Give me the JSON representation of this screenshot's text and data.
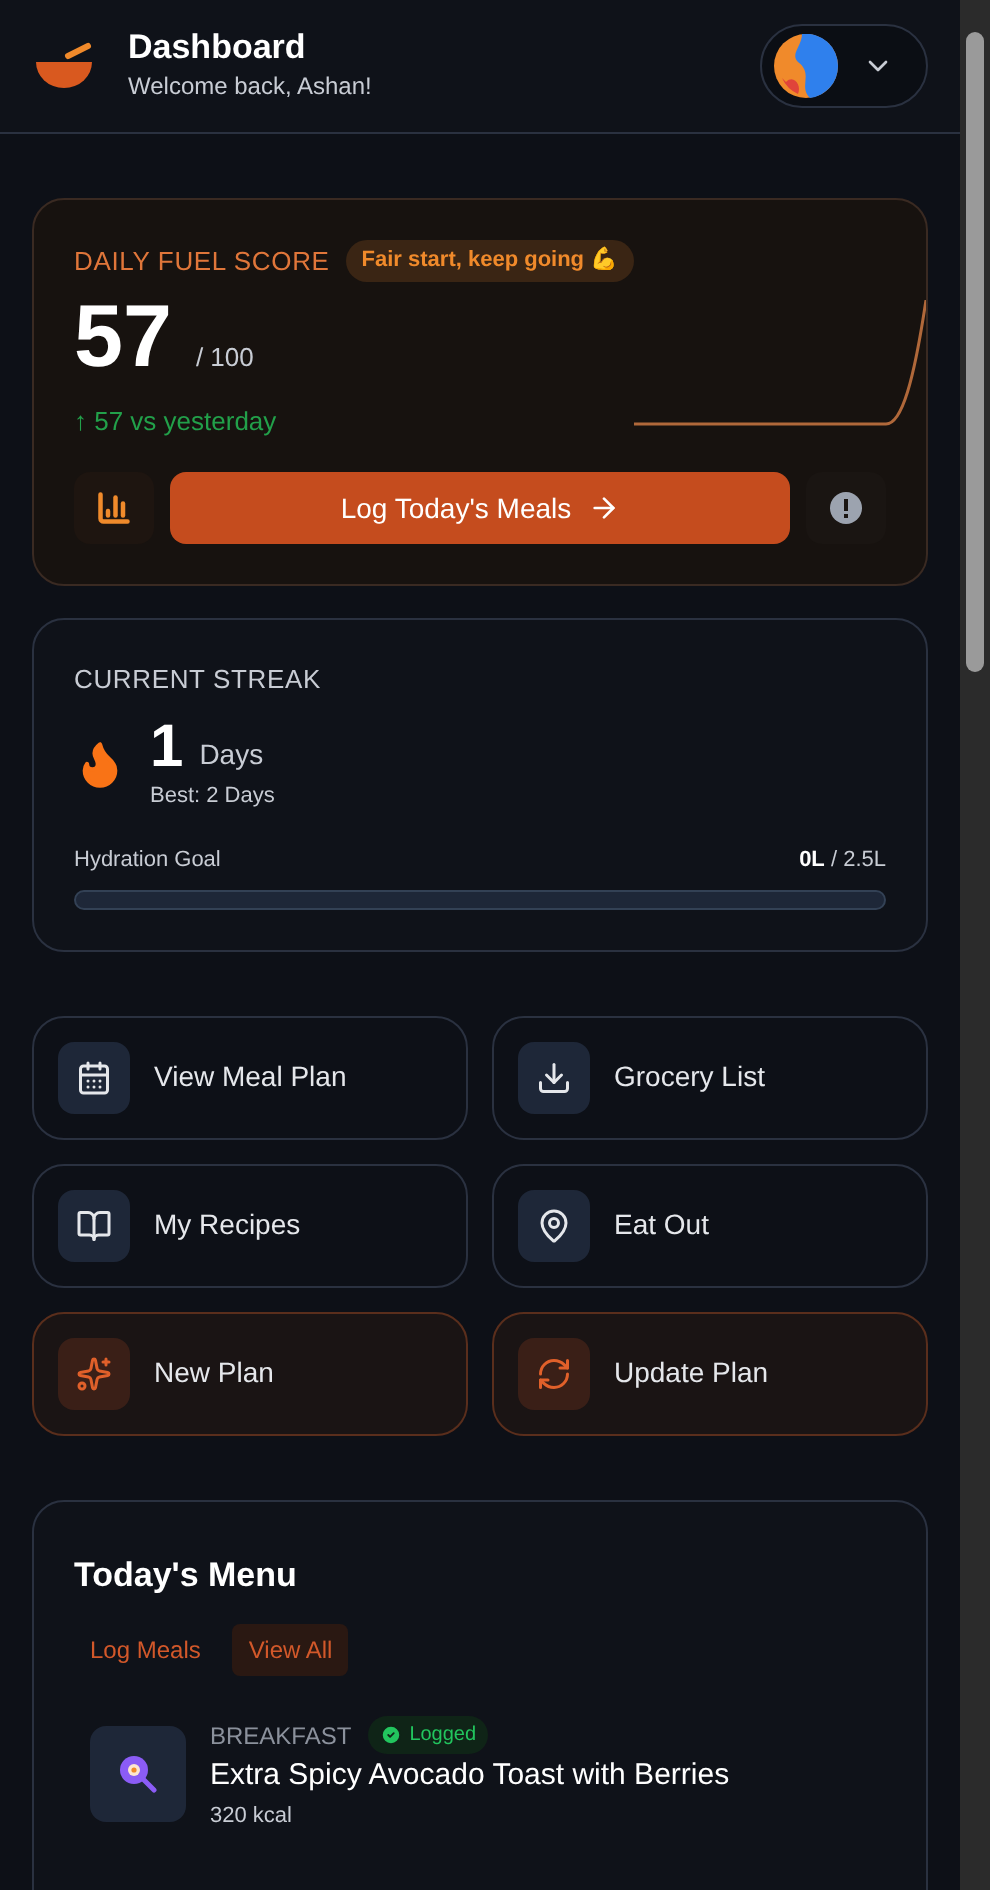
{
  "header": {
    "title": "Dashboard",
    "subtitle": "Welcome back, Ashan!"
  },
  "fuel_score": {
    "label": "DAILY FUEL SCORE",
    "badge": "Fair start, keep going 💪",
    "score": "57",
    "max": "/ 100",
    "change": "↑ 57 vs yesterday",
    "button": "Log Today's Meals"
  },
  "streak": {
    "label": "CURRENT STREAK",
    "count": "1",
    "unit": "Days",
    "best": "Best: 2 Days",
    "hydration_label": "Hydration Goal",
    "hydration_current": "0L",
    "hydration_goal": "/ 2.5L",
    "level": 0
  },
  "actions": [
    {
      "label": "View Meal Plan",
      "kind": "normal"
    },
    {
      "label": "Grocery List",
      "kind": "normal"
    },
    {
      "label": "My Recipes",
      "kind": "normal"
    },
    {
      "label": "Eat Out",
      "kind": "normal"
    },
    {
      "label": "New Plan",
      "kind": "accent"
    },
    {
      "label": "Update Plan",
      "kind": "accent"
    }
  ],
  "menu": {
    "title": "Today's Menu",
    "tabs": [
      {
        "label": "Log Meals",
        "selected": false
      },
      {
        "label": "View All",
        "selected": true
      }
    ],
    "meals": [
      {
        "type": "BREAKFAST",
        "logged": true,
        "status": "Logged",
        "name": "Extra Spicy Avocado Toast with Berries",
        "calories": "320 kcal"
      }
    ]
  }
}
